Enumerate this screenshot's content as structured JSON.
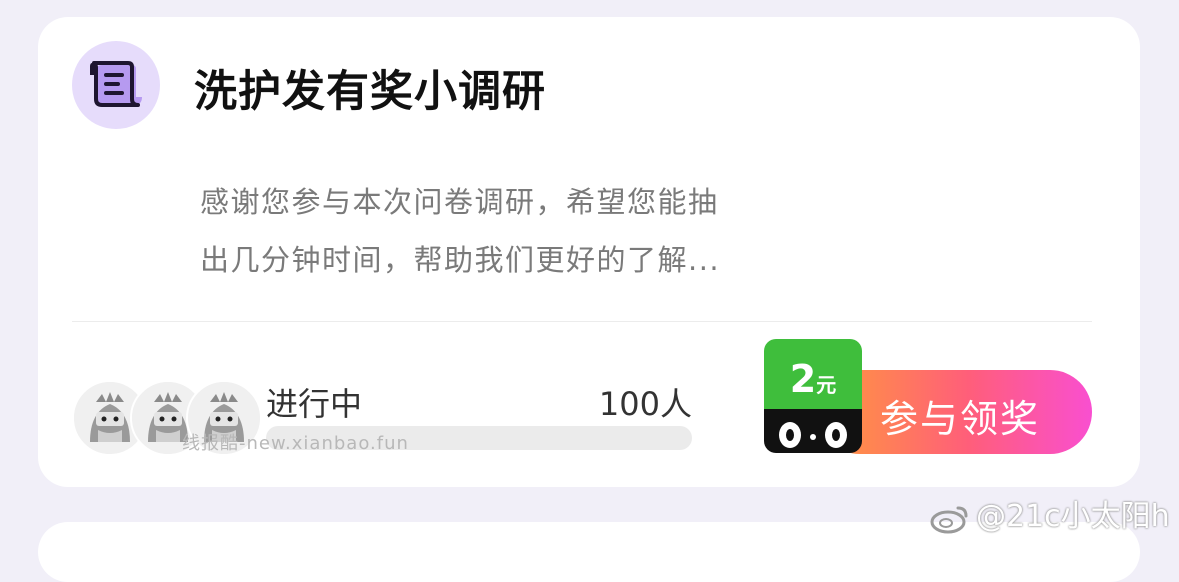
{
  "survey": {
    "title": "洗护发有奖小调研",
    "description_lines": [
      "感谢您参与本次问卷调研，希望您能抽",
      "出几分钟时间，帮助我们更好的了解..."
    ],
    "status": "进行中",
    "participants": "100人",
    "cta_label": "参与领奖",
    "reward": {
      "amount": "2",
      "unit": "元"
    },
    "icon": "scroll-icon"
  },
  "watermark": "线报酷-new.xianbao.fun",
  "weibo_handle": "@21c小太阳h",
  "colors": {
    "accent_purple": "#e6dcfb",
    "reward_green": "#3fbe3c",
    "cta_gradient_start": "#ff9a3c",
    "cta_gradient_end": "#f94fd0"
  }
}
